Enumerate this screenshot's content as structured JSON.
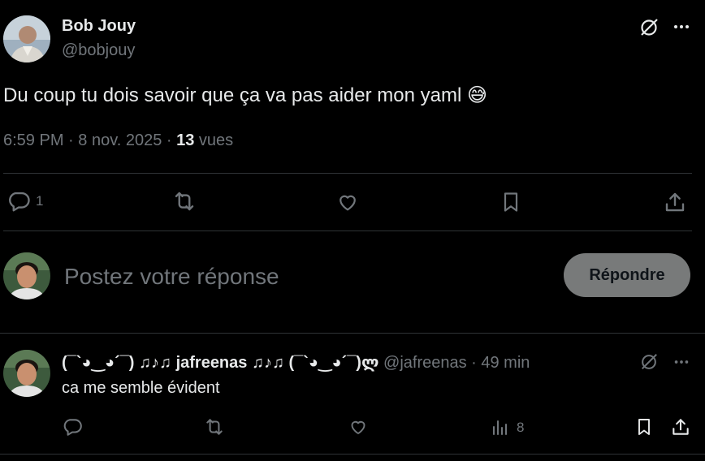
{
  "tweet": {
    "author_name": "Bob Jouy",
    "author_handle": "@bobjouy",
    "text": "Du coup tu dois savoir que ça va pas aider mon yaml",
    "emoji": "😅",
    "time": "6:59 PM",
    "date": "8 nov. 2025",
    "views_count": "13",
    "views_label": "vues",
    "reply_count": "1"
  },
  "composer": {
    "placeholder": "Postez votre réponse",
    "reply_button": "Répondre"
  },
  "reply": {
    "display_name": "(¯`◕‿◕´¯) ♫♪♫ jafreenas ♫♪♫ (¯`◕‿◕´¯)ლ",
    "handle": "@jafreenas",
    "time": "49 min",
    "text": "ca me semble évident",
    "views": "8"
  },
  "colors": {
    "background": "#000000",
    "text": "#e7e9ea",
    "muted": "#71767b",
    "divider": "#2f3336",
    "button_bg": "#787a7a"
  }
}
